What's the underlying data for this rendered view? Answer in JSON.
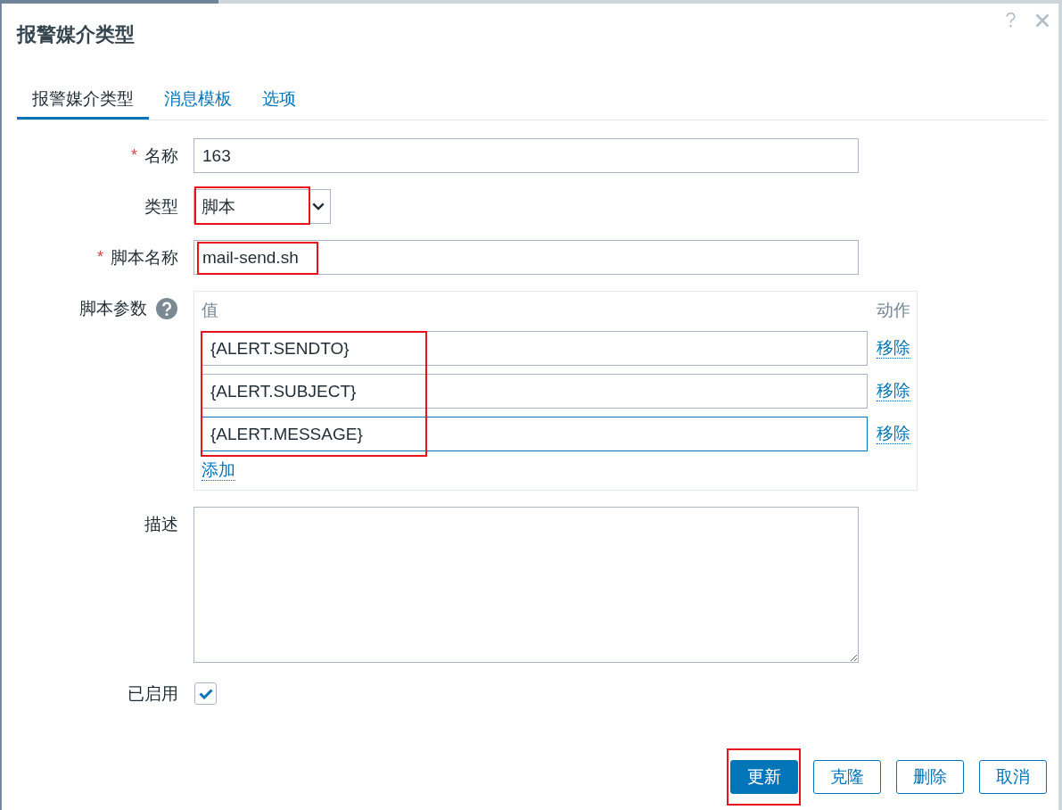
{
  "dialog": {
    "title": "报警媒介类型"
  },
  "tabs": [
    {
      "label": "报警媒介类型",
      "selected": true
    },
    {
      "label": "消息模板",
      "selected": false
    },
    {
      "label": "选项",
      "selected": false
    }
  ],
  "form": {
    "fields": [
      {
        "kind": "text",
        "label": "名称",
        "required_mark": "*",
        "value": "163",
        "highlighted": false
      },
      {
        "kind": "select",
        "label": "类型",
        "value": "脚本",
        "highlighted": true
      },
      {
        "kind": "text",
        "label": "脚本名称",
        "required_mark": "*",
        "value": "mail-send.sh",
        "highlighted": true
      },
      {
        "kind": "params",
        "label": "脚本参数",
        "help": true,
        "columns": [
          "值",
          "动作"
        ],
        "rows": [
          {
            "value": "{ALERT.SENDTO}",
            "action": "移除",
            "focused": false
          },
          {
            "value": "{ALERT.SUBJECT}",
            "action": "移除",
            "focused": false
          },
          {
            "value": "{ALERT.MESSAGE}",
            "action": "移除",
            "focused": true
          }
        ],
        "add_link": "添加",
        "highlighted": true
      },
      {
        "kind": "textarea",
        "label": "描述",
        "highlighted": false
      },
      {
        "kind": "checkbox",
        "label": "已启用",
        "checked": true,
        "highlighted": false
      }
    ]
  },
  "buttons": [
    {
      "label": "更新",
      "primary": true,
      "highlighted": true
    },
    {
      "label": "克隆",
      "primary": false,
      "highlighted": false
    },
    {
      "label": "删除",
      "primary": false,
      "highlighted": false
    },
    {
      "label": "取消",
      "primary": false,
      "highlighted": false
    }
  ]
}
